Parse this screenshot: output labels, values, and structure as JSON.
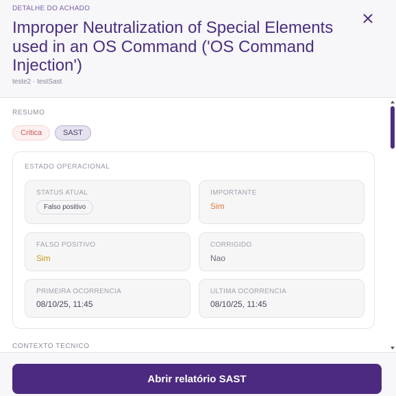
{
  "header": {
    "eyebrow": "DETALHE DO ACHADO",
    "title": "Improper Neutralization of Special Elements used in an OS Command ('OS Command Injection')",
    "subtitle": "teste2 · testSast",
    "close_icon": "close-icon"
  },
  "summary": {
    "label": "RESUMO",
    "badges": [
      {
        "label": "Critica",
        "color": "#d0545a"
      },
      {
        "label": "SAST",
        "color": "#4c3f6e"
      }
    ]
  },
  "operational": {
    "label": "ESTADO OPERACIONAL",
    "fields": {
      "status_atual": {
        "label": "STATUS ATUAL",
        "value": "Falso positivo"
      },
      "importante": {
        "label": "IMPORTANTE",
        "value": "Sim"
      },
      "falso_positivo": {
        "label": "FALSO POSITIVO",
        "value": "Sim"
      },
      "corrigido": {
        "label": "CORRIGIDO",
        "value": "Nao"
      },
      "primeira_ocorrencia": {
        "label": "PRIMEIRA OCORRENCIA",
        "value": "08/10/25, 11:45"
      },
      "ultima_ocorrencia": {
        "label": "ULTIMA OCORRENCIA",
        "value": "08/10/25, 11:45"
      }
    }
  },
  "technical": {
    "label": "CONTEXTO TECNICO"
  },
  "footer": {
    "primary_label": "Abrir relatório SAST"
  },
  "colors": {
    "accent": "#4b2a7f",
    "critical": "#d0545a",
    "important": "#e07a3c",
    "false_positive": "#c99a1a"
  }
}
